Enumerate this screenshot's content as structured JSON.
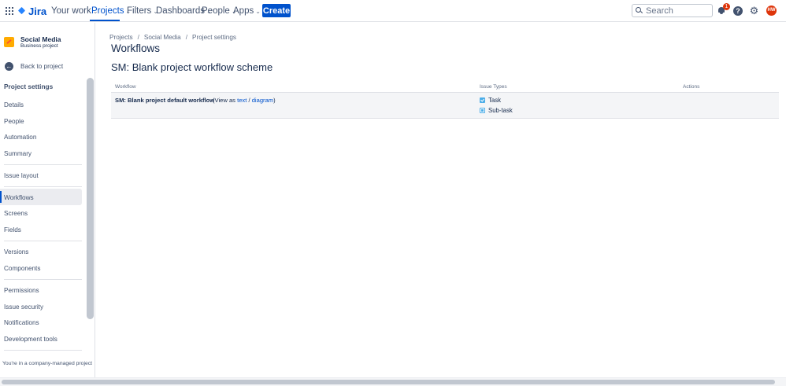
{
  "topnav": {
    "logo": "Jira",
    "items": [
      {
        "label": "Your work"
      },
      {
        "label": "Projects"
      },
      {
        "label": "Filters"
      },
      {
        "label": "Dashboards"
      },
      {
        "label": "People"
      },
      {
        "label": "Apps"
      }
    ],
    "active_item": "Projects",
    "create_label": "Create",
    "search_placeholder": "Search",
    "notification_count": "1",
    "avatar_initials": "HW"
  },
  "sidebar": {
    "project_name": "Social Media",
    "project_type": "Business project",
    "back_label": "Back to project",
    "section_title": "Project settings",
    "groups": [
      [
        "Details",
        "People",
        "Automation",
        "Summary"
      ],
      [
        "Issue layout"
      ],
      [
        "Workflows",
        "Screens",
        "Fields"
      ],
      [
        "Versions",
        "Components"
      ],
      [
        "Permissions",
        "Issue security",
        "Notifications",
        "Development tools"
      ]
    ],
    "active_item": "Workflows",
    "footer_note": "You're in a company-managed project"
  },
  "main": {
    "breadcrumbs": [
      "Projects",
      "Social Media",
      "Project settings"
    ],
    "page_title": "Workflows",
    "scheme_title": "SM: Blank project workflow scheme",
    "table": {
      "headers": [
        "Workflow",
        "Issue Types",
        "Actions"
      ],
      "rows": [
        {
          "workflow": "SM: Blank project default workflow",
          "view_as_prefix": "(View as ",
          "view_text_link": "text",
          "view_sep": " / ",
          "view_diagram_link": "diagram",
          "view_suffix": ")",
          "issue_types": [
            {
              "label": "Task",
              "icon": "task-icon"
            },
            {
              "label": "Sub-task",
              "icon": "subtask-icon"
            }
          ]
        }
      ]
    }
  },
  "colors": {
    "brand": "#0052cc",
    "badge": "#de350b",
    "avatar": "#de350b",
    "issue_icon": "#4bade8"
  }
}
